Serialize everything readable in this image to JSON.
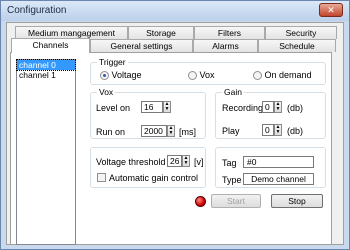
{
  "window": {
    "title": "Configuration",
    "close_glyph": "✕"
  },
  "tabs": {
    "row1": [
      "Medium mangagement",
      "Storage",
      "Filters",
      "Security"
    ],
    "row2": [
      "Channels",
      "General settings",
      "Alarms",
      "Schedule"
    ],
    "active": "Channels"
  },
  "channels": [
    "channel 0",
    "channel 1"
  ],
  "trigger": {
    "label": "Trigger",
    "options": [
      "Voltage",
      "Vox",
      "On demand"
    ],
    "selected": "Voltage"
  },
  "vox": {
    "label": "Vox",
    "level_on_label": "Level on",
    "level_on_value": "16",
    "run_on_label": "Run on",
    "run_on_value": "2000",
    "run_on_unit": "[ms]"
  },
  "gain": {
    "label": "Gain",
    "recording_label": "Recording",
    "recording_value": "0",
    "recording_unit": "(db)",
    "play_label": "Play",
    "play_value": "0",
    "play_unit": "(db)"
  },
  "voltage": {
    "threshold_label": "Voltage threshold",
    "threshold_value": "26",
    "threshold_unit": "[v]",
    "agc_label": "Automatic gain control",
    "agc_checked": false
  },
  "info": {
    "tag_label": "Tag",
    "tag_value": "#0",
    "type_label": "Type",
    "type_value": "Demo channel"
  },
  "buttons": {
    "start": "Start",
    "stop": "Stop"
  },
  "colors": {
    "accent": "#3399ff",
    "led": "#d40000"
  }
}
